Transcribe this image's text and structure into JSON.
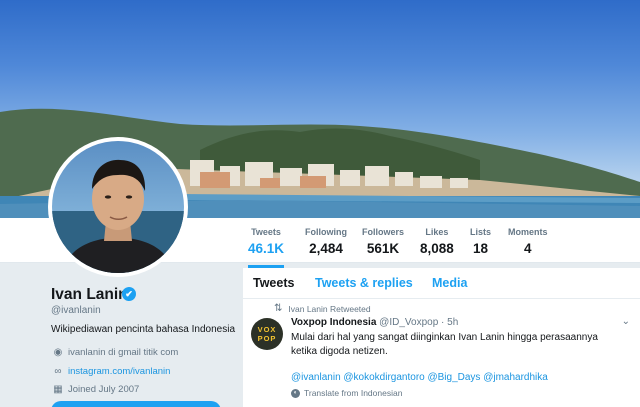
{
  "stats": [
    {
      "label": "Tweets",
      "value": "46.1K"
    },
    {
      "label": "Following",
      "value": "2,484"
    },
    {
      "label": "Followers",
      "value": "561K"
    },
    {
      "label": "Likes",
      "value": "8,088"
    },
    {
      "label": "Lists",
      "value": "18"
    },
    {
      "label": "Moments",
      "value": "4"
    }
  ],
  "profile": {
    "name": "Ivan Lanin",
    "verified_mark": "✔",
    "handle": "@ivanlanin",
    "bio": "Wikipediawan pencinta bahasa Indonesia",
    "location": "ivanlanin di gmail titik com",
    "website": "instagram.com/ivanlanin",
    "joined": "Joined July 2007"
  },
  "tabs": [
    "Tweets",
    "Tweets & replies",
    "Media"
  ],
  "tweet": {
    "retweet_context": "Ivan Lanin Retweeted",
    "avatar_text_top": "VOX",
    "avatar_text_bottom": "POP",
    "account_name": "Voxpop Indonesia",
    "account_handle_time": "@ID_Voxpop · 5h",
    "body": "Mulai dari hal yang sangat diinginkan Ivan Lanin hingga perasaannya ketika digoda netizen.",
    "mentions": "@ivanlanin @kokokdirgantoro @Big_Days @jmahardhika",
    "translate": "Translate from Indonesian"
  },
  "icons": {
    "location": "location-pin-icon",
    "website": "link-icon",
    "joined": "calendar-icon",
    "retweet": "retweet-icon",
    "globe": "globe-icon",
    "caret": "chevron-down-icon"
  },
  "colors": {
    "accent": "#1da1f2",
    "link": "#1b95e0",
    "muted": "#657786",
    "background": "#e6ecf0"
  }
}
